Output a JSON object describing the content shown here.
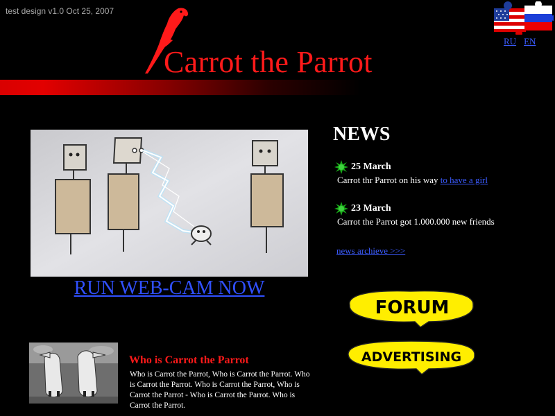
{
  "header": {
    "version": "test design v1.0 Oct 25, 2007",
    "site_title": "Carrot the Parrot",
    "languages": [
      "RU",
      "EN"
    ]
  },
  "webcam": {
    "link_text": "RUN WEB-CAM NOW"
  },
  "news": {
    "heading": "NEWS",
    "items": [
      {
        "date": "25 March",
        "text": "Carrot thr Parrot on his way ",
        "link": "to have a girl"
      },
      {
        "date": "23 March",
        "text": "Carrot the Parrot got 1.000.000 new friends",
        "link": ""
      }
    ],
    "archive_link": "news archieve >>>"
  },
  "buttons": {
    "forum": "FORUM",
    "advertising": "ADVERTISING"
  },
  "who": {
    "heading": "Who is Carrot the Parrot",
    "text": "Who is Carrot the Parrot, Who is Carrot the Parrot. Who is Carrot the Parrot. Who is Carrot the Parrot, Who is Carrot the Parrot - Who is Carrot the Parrot. Who is Carrot the Parrot."
  },
  "colors": {
    "background": "#000000",
    "title_red": "#ff1a1a",
    "link_blue": "#3050ff",
    "button_yellow": "#ffee00"
  }
}
